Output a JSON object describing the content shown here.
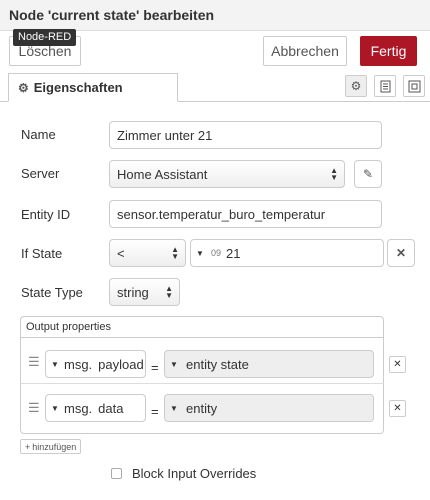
{
  "header": {
    "title": "Node 'current state' bearbeiten"
  },
  "tooltip": "Node-RED",
  "toolbar": {
    "delete_label": "Löschen",
    "cancel_label": "Abbrechen",
    "done_label": "Fertig"
  },
  "tabs": {
    "properties_label": "Eigenschaften"
  },
  "form": {
    "name_label": "Name",
    "name_value": "Zimmer unter 21",
    "server_label": "Server",
    "server_value": "Home Assistant",
    "entity_label": "Entity ID",
    "entity_value": "sensor.temperatur_buro_temperatur",
    "ifstate_label": "If State",
    "ifstate_operator": "<",
    "ifstate_type_glyph": "09",
    "ifstate_value": "21",
    "statetype_label": "State Type",
    "statetype_value": "string"
  },
  "output": {
    "title": "Output properties",
    "rows": [
      {
        "prefix": "msg.",
        "property": "payload",
        "eq": "=",
        "value": "entity state"
      },
      {
        "prefix": "msg.",
        "property": "data",
        "eq": "=",
        "value": "entity"
      }
    ],
    "add_label": "hinzufügen"
  },
  "block_input_overrides_label": "Block Input Overrides"
}
